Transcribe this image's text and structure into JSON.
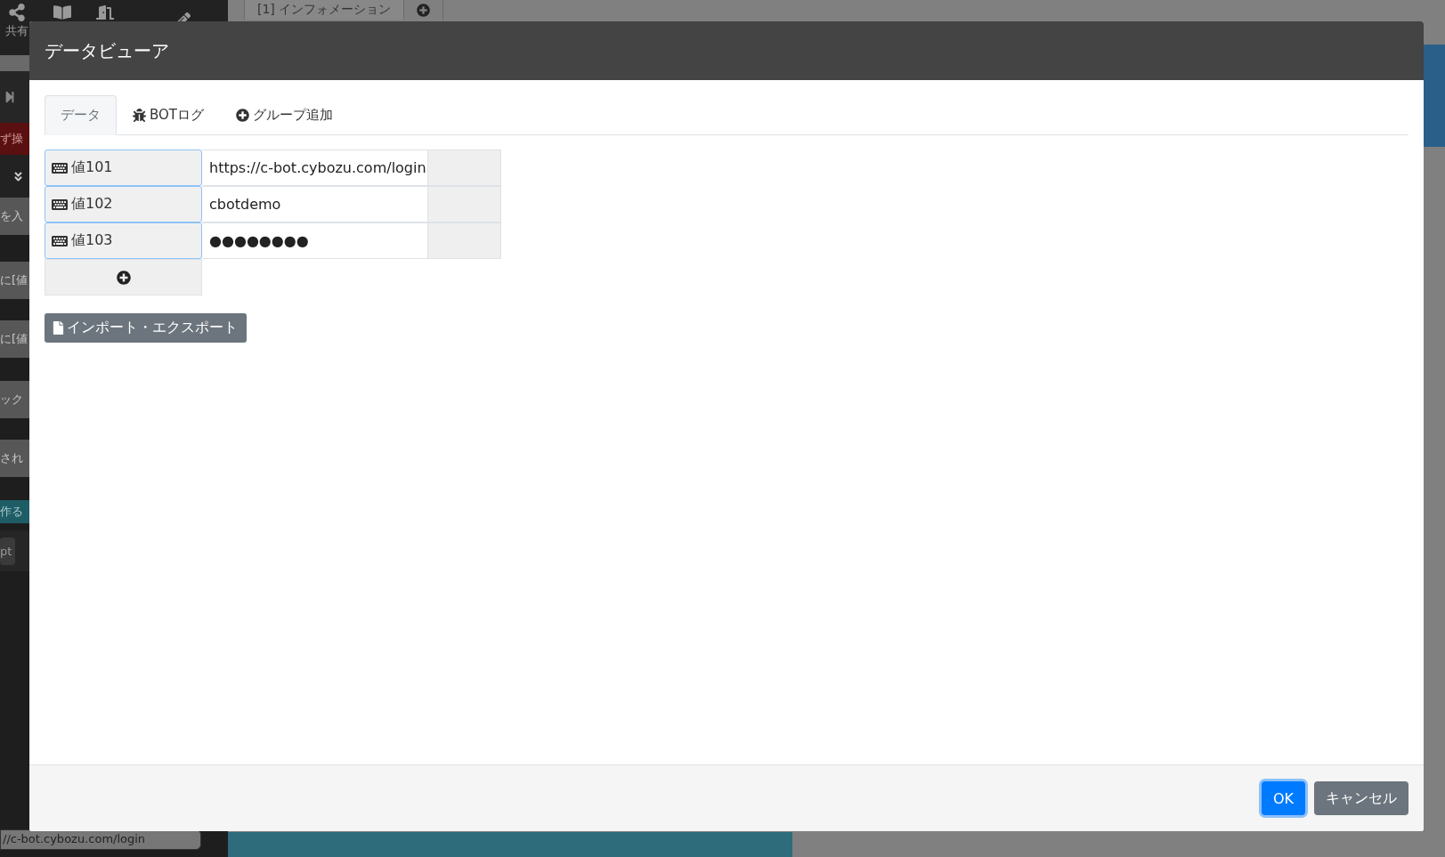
{
  "background": {
    "toolbar_label": "共有",
    "tab": "[1] インフォメーション",
    "side_items": [
      {
        "kind": "alert",
        "text": "ず操"
      },
      {
        "kind": "step",
        "text": "を入"
      },
      {
        "kind": "step",
        "text": "に[値"
      },
      {
        "kind": "step",
        "text": "に[値"
      },
      {
        "kind": "step",
        "text": "ック"
      },
      {
        "kind": "step",
        "text": "され"
      },
      {
        "kind": "create",
        "text": "作る"
      },
      {
        "kind": "chip",
        "text": "pt"
      }
    ],
    "url_field": "//c-bot.cybozu.com/login"
  },
  "dialog": {
    "title": "データビューア",
    "tabs": [
      {
        "label": "データ",
        "selected": true,
        "kind": "plain"
      },
      {
        "label": "BOTログ",
        "selected": false,
        "kind": "log"
      },
      {
        "label": "グループ追加",
        "selected": false,
        "kind": "add"
      }
    ],
    "rows": [
      {
        "name": "値101",
        "value": "https://c-bot.cybozu.com/login"
      },
      {
        "name": "値102",
        "value": "cbotdemo"
      },
      {
        "name": "値103",
        "value": "●●●●●●●●"
      }
    ],
    "import_button": "インポート・エクスポート",
    "buttons": [
      {
        "label": "OK",
        "kind": "primary"
      },
      {
        "label": "キャンセル",
        "kind": "secondary"
      }
    ]
  }
}
